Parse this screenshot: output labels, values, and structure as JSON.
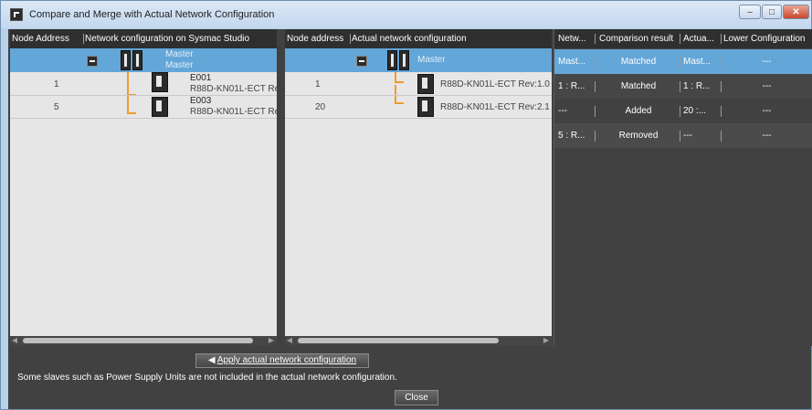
{
  "window": {
    "title": "Compare and Merge with Actual Network Configuration",
    "buttons": {
      "minimize": "–",
      "maximize": "□",
      "close": "✕"
    }
  },
  "left_panel": {
    "headers": [
      "Node Address",
      "Network configuration on Sysmac Studio"
    ],
    "master": {
      "name": "Master",
      "sub": "Master"
    },
    "rows": [
      {
        "address": "1",
        "name": "E001",
        "device": "R88D-KN01L-ECT Re"
      },
      {
        "address": "5",
        "name": "E003",
        "device": "R88D-KN01L-ECT Re"
      }
    ]
  },
  "middle_panel": {
    "headers": [
      "Node address",
      "Actual network configuration"
    ],
    "master": {
      "name": "Master"
    },
    "rows": [
      {
        "address": "1",
        "device": "R88D-KN01L-ECT Rev:1.0"
      },
      {
        "address": "20",
        "device": "R88D-KN01L-ECT Rev:2.1"
      }
    ]
  },
  "comparison_table": {
    "headers": [
      "Netw...",
      "Comparison result",
      "Actua...",
      "Lower Configuration"
    ],
    "rows": [
      [
        "Mast...",
        "Matched",
        "Mast...",
        "---"
      ],
      [
        "1 : R...",
        "Matched",
        "1 : R...",
        "---"
      ],
      [
        "---",
        "Added",
        "20 :...",
        "---"
      ],
      [
        "5 : R...",
        "Removed",
        "---",
        "---"
      ]
    ]
  },
  "apply_button": {
    "icon": "◀",
    "label": "Apply actual network configuration"
  },
  "note": "Some slaves such as Power Supply Units are not included in the actual network configuration.",
  "close_button": "Close",
  "colors": {
    "accent": "#63a6d8",
    "connector": "#f39a2d",
    "background": "#414141"
  }
}
